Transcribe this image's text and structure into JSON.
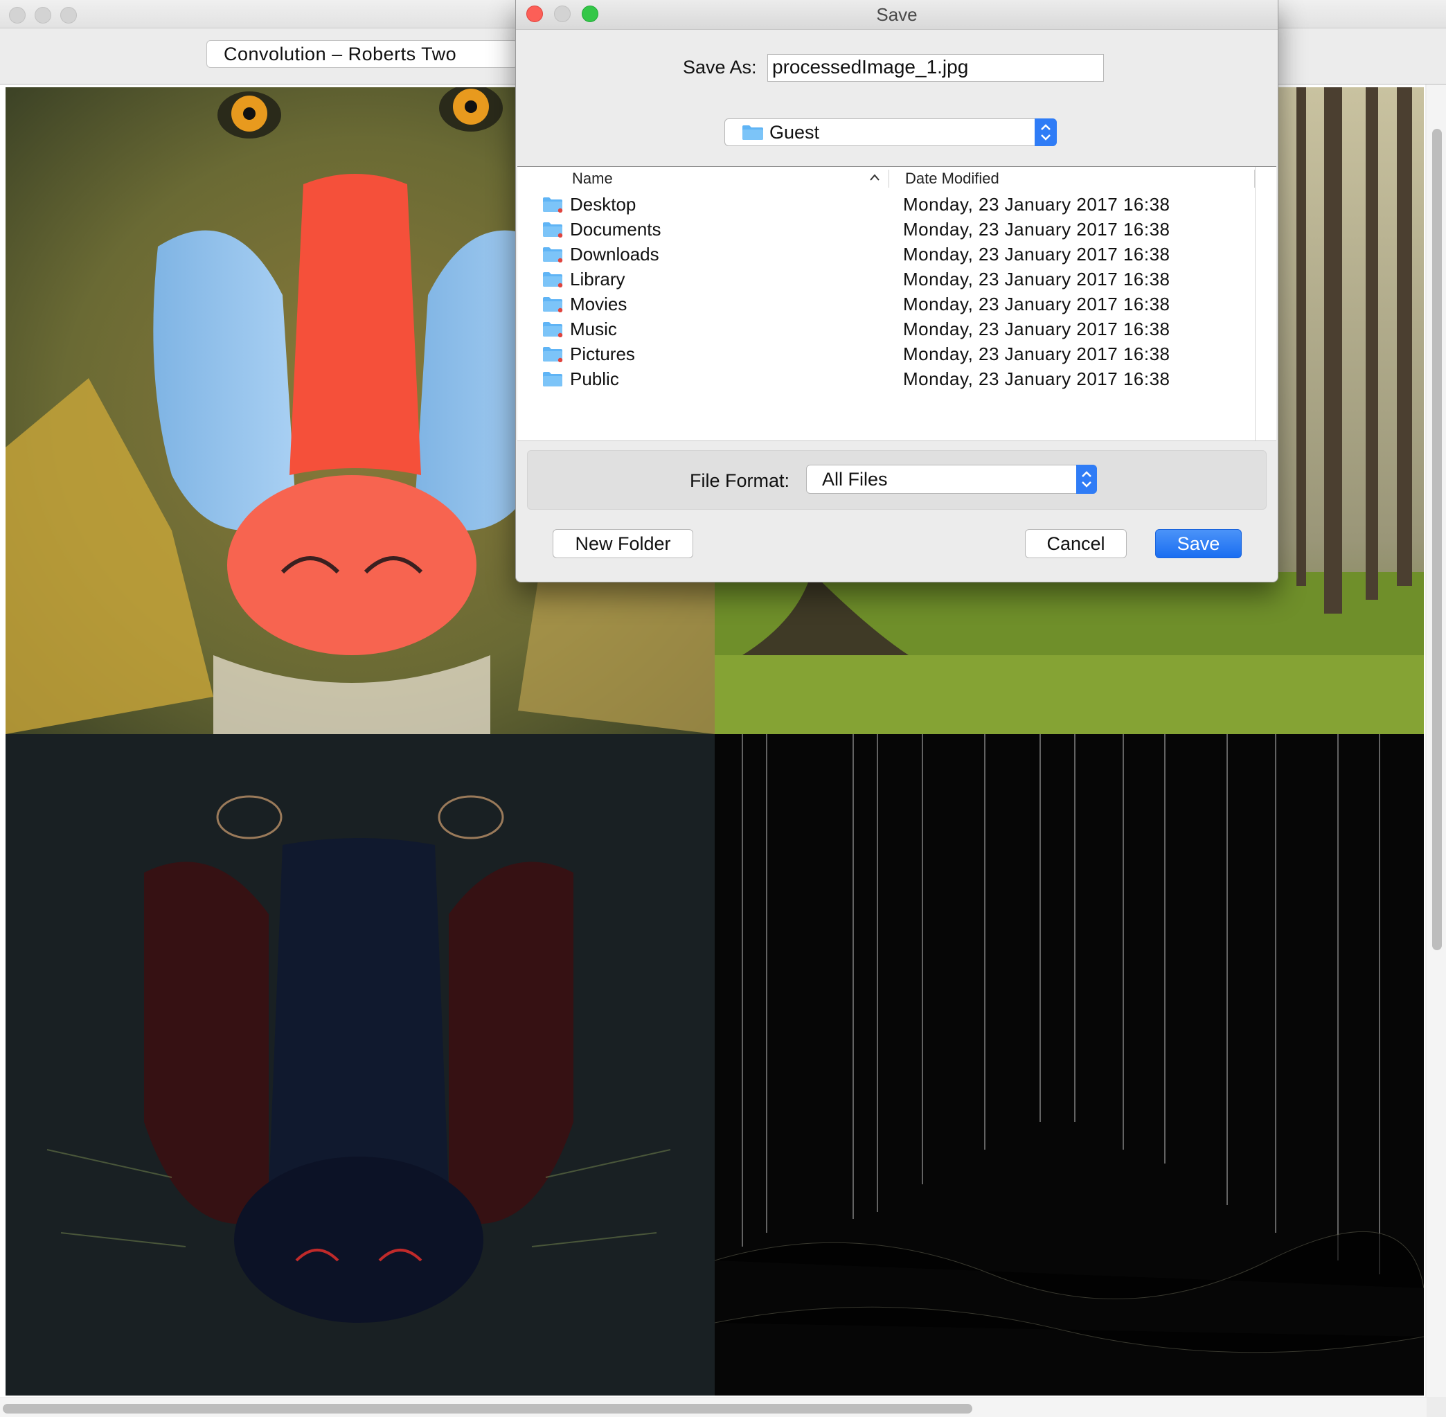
{
  "main_window": {
    "operation_select_value": "Convolution – Roberts Two"
  },
  "dialog": {
    "title": "Save",
    "save_as_label": "Save As:",
    "filename_value": "processedImage_1.jpg",
    "location_value": "Guest",
    "columns": {
      "name": "Name",
      "date_modified": "Date Modified"
    },
    "files": [
      {
        "name": "Desktop",
        "date": "Monday, 23 January 2017 16:38",
        "badge": true
      },
      {
        "name": "Documents",
        "date": "Monday, 23 January 2017 16:38",
        "badge": true
      },
      {
        "name": "Downloads",
        "date": "Monday, 23 January 2017 16:38",
        "badge": true
      },
      {
        "name": "Library",
        "date": "Monday, 23 January 2017 16:38",
        "badge": true
      },
      {
        "name": "Movies",
        "date": "Monday, 23 January 2017 16:38",
        "badge": true
      },
      {
        "name": "Music",
        "date": "Monday, 23 January 2017 16:38",
        "badge": true
      },
      {
        "name": "Pictures",
        "date": "Monday, 23 January 2017 16:38",
        "badge": true
      },
      {
        "name": "Public",
        "date": "Monday, 23 January 2017 16:38",
        "badge": false
      }
    ],
    "file_format_label": "File Format:",
    "file_format_value": "All Files",
    "new_folder_label": "New Folder",
    "cancel_label": "Cancel",
    "save_label": "Save"
  },
  "colors": {
    "accent": "#2f7cf6",
    "close": "#fc5f57",
    "minimize": "#d3d3d3",
    "zoom": "#34c748",
    "folder": "#5fb4f5"
  }
}
